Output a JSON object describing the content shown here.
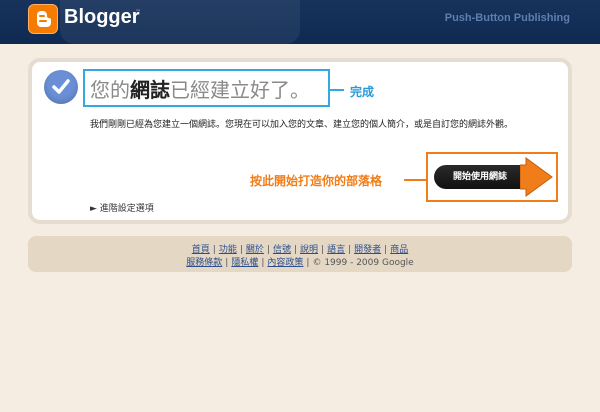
{
  "header": {
    "brand": "Blogger",
    "tm": "™",
    "tagline": "Push-Button Publishing",
    "logo_icon": "blogger-b-icon"
  },
  "main": {
    "title_pre": "您的",
    "title_bold": "網誌",
    "title_post": "已經建立好了。",
    "done_label": "完成",
    "description": "我們剛剛已經為您建立一個網誌。您現在可以加入您的文章、建立您的個人簡介，或是自訂您的網誌外觀。",
    "start_label": "按此開始打造你的部落格",
    "start_button": "開始使用網誌",
    "advanced_link": "► 進階設定選項",
    "check_icon": "checkmark-icon"
  },
  "footer": {
    "row1": [
      "首頁",
      "功能",
      "關於",
      "信號",
      "說明",
      "語言",
      "開發者",
      "商品"
    ],
    "row2": [
      "服務條款",
      "隱私權",
      "內容政策"
    ],
    "copyright": "© 1999 - 2009 Google"
  },
  "colors": {
    "header_bg": "#17325c",
    "page_bg": "#f5ede2",
    "highlight_blue": "#33aadf",
    "accent_orange": "#f07d1a",
    "check_blue": "#6b8fd6"
  }
}
